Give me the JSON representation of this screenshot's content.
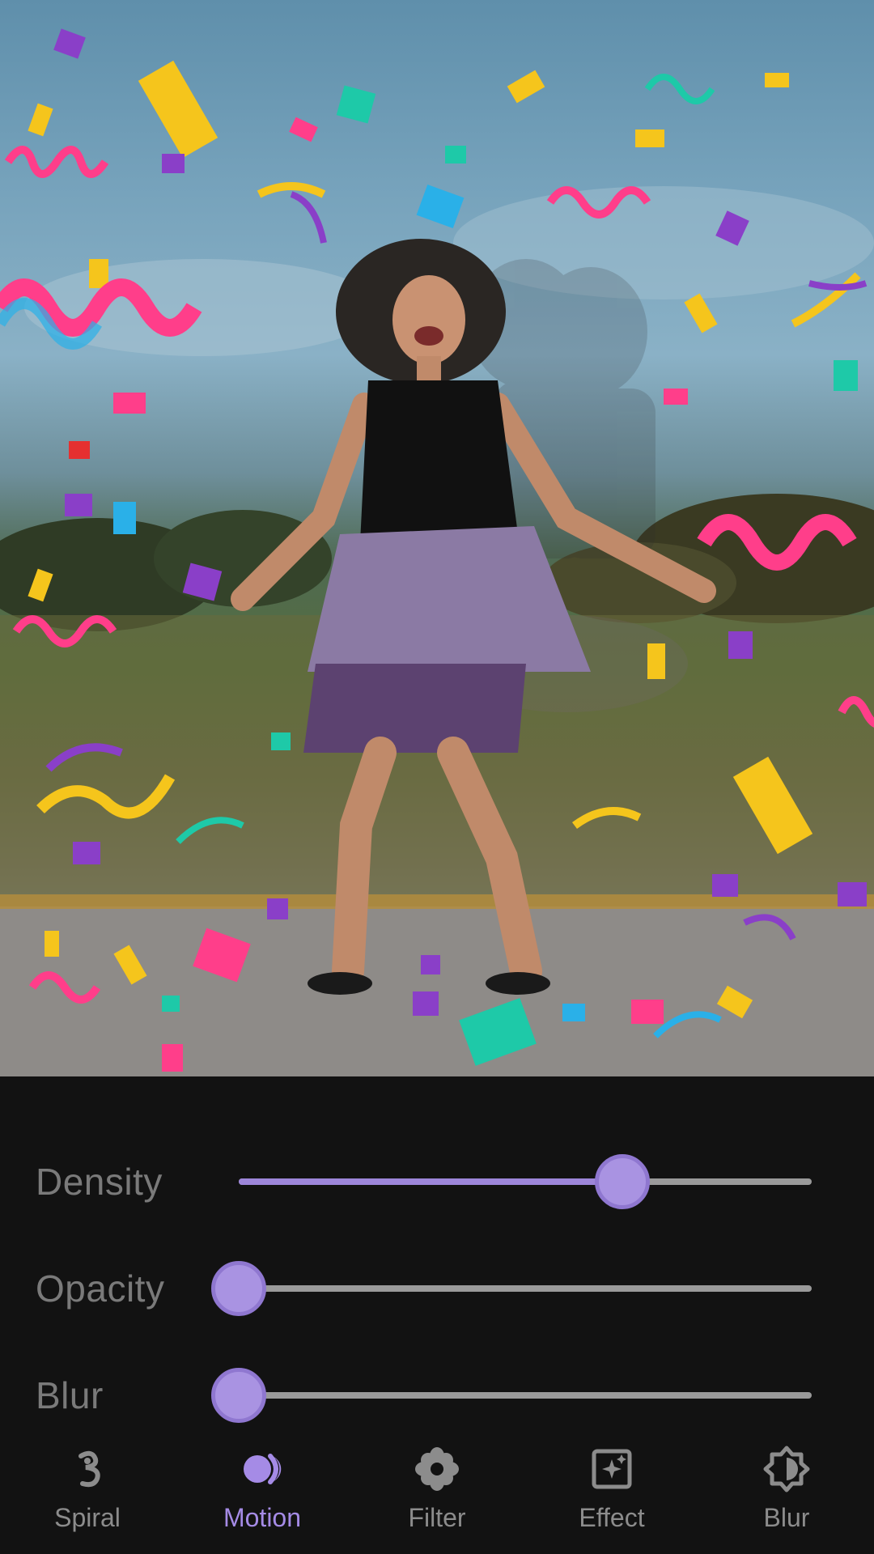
{
  "sliders": [
    {
      "label": "Density",
      "value": 0.67
    },
    {
      "label": "Opacity",
      "value": 0.0
    },
    {
      "label": "Blur",
      "value": 0.0
    }
  ],
  "nav": {
    "active": "Motion",
    "items": [
      {
        "label": "Spiral",
        "icon": "spiral-icon"
      },
      {
        "label": "Motion",
        "icon": "motion-icon"
      },
      {
        "label": "Filter",
        "icon": "flower-icon"
      },
      {
        "label": "Effect",
        "icon": "sparkle-icon"
      },
      {
        "label": "Blur",
        "icon": "blur-icon"
      }
    ]
  },
  "colors": {
    "accent": "#a58be6",
    "panel_bg": "#121212",
    "inactive": "#8c8c8c",
    "track": "#9a9a9a"
  }
}
